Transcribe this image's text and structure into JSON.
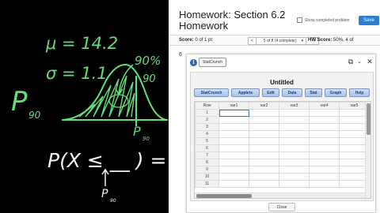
{
  "whiteboard": {
    "mu_line": "μ = 14.2",
    "sigma_line": "σ = 1.1",
    "p_label": "P",
    "p_subscript": "90",
    "percent": "90%",
    "decimal": ".90",
    "curve_label": "P",
    "curve_label_sub": "90",
    "equation": "P(X ≤ __ ) = .90",
    "arrow_label": "P",
    "arrow_label_sub": "90",
    "colors": {
      "green": "#5fe07a",
      "white": "#f2f2f2"
    }
  },
  "homework": {
    "title": "Homework: Section 6.2 Homework",
    "show_completed_label": "Show completed problem",
    "save_label": "Save",
    "score_label": "Score:",
    "score_value": "0 of 1 pt",
    "nav_prev": "<",
    "nav_text": "5 of 8 (4 complete)",
    "nav_dropdown": "▾",
    "nav_next": ">",
    "hw_score_label": "HW Score:",
    "hw_score_value": "50%, 4 of",
    "question_number": "6"
  },
  "statcrunch": {
    "tab_label": "StatCrunch",
    "title": "Untitled",
    "menu": [
      "StatCrunch",
      "Applets",
      "Edit",
      "Data",
      "Stat",
      "Graph",
      "Help"
    ],
    "columns": [
      "Row",
      "var1",
      "var2",
      "var3",
      "var4",
      "var5"
    ],
    "rows": [
      "1",
      "2",
      "3",
      "4",
      "5",
      "6",
      "7",
      "8",
      "9",
      "10",
      "11"
    ],
    "close_label": "Close",
    "accent": "#2b78d8"
  }
}
